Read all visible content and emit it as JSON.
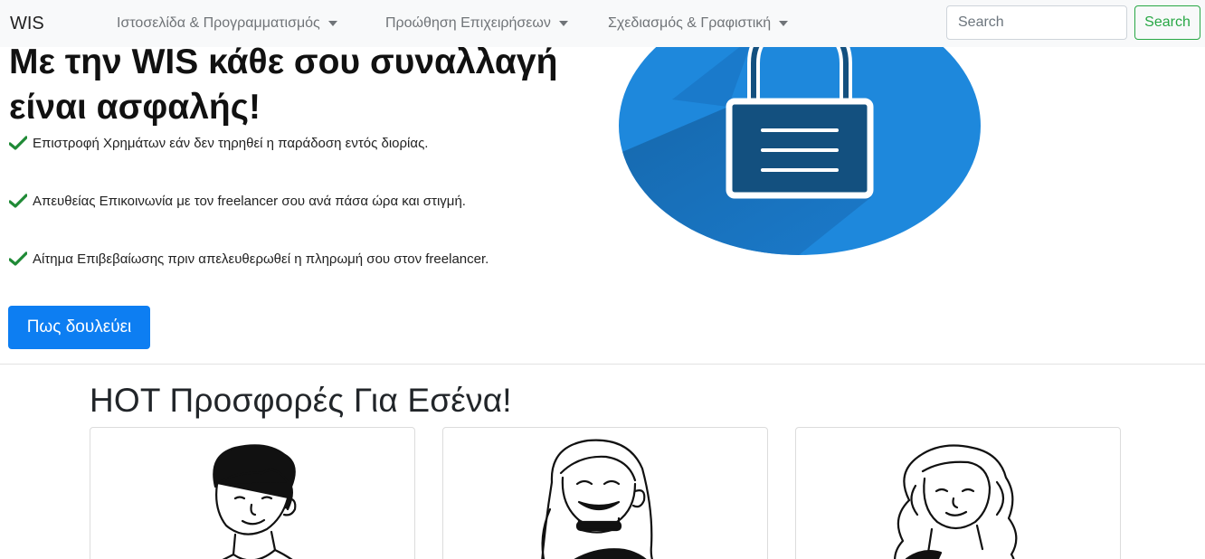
{
  "navbar": {
    "brand": "WIS",
    "items": [
      {
        "label": "Ιστοσελίδα & Προγραμματισμός"
      },
      {
        "label": "Προώθηση Επιχειρήσεων"
      },
      {
        "label": "Σχεδιασμός & Γραφιστική"
      }
    ],
    "search": {
      "placeholder": "Search",
      "button_label": "Search"
    }
  },
  "hero": {
    "title_line1": "Με την WIS κάθε σου συναλλαγή",
    "title_line2": "είναι ασφαλής!",
    "benefits": [
      {
        "text": "Επιστροφή Χρημάτων εάν δεν τηρηθεί η παράδοση εντός διορίας."
      },
      {
        "text": "Απευθείας Επικοινωνία με τον freelancer σου ανά πάσα ώρα και στιγμή."
      },
      {
        "text": "Αίτημα Επιβεβαίωσης πριν απελευθερωθεί η πληρωμή σου στον freelancer."
      }
    ],
    "button_label": "Πως δουλεύει"
  },
  "offers": {
    "title": "HOT Προσφορές Για Εσένα!",
    "cards": [
      {
        "image": "man-avatar-illustration"
      },
      {
        "image": "woman-avatar-laughing-illustration"
      },
      {
        "image": "woman-avatar-curly-hair-illustration"
      }
    ]
  },
  "colors": {
    "primary": "#0d7ef2",
    "success": "#28a745",
    "check": "#28a745",
    "lock_circle": "#1e88dc",
    "lock_dark": "#13507f"
  }
}
